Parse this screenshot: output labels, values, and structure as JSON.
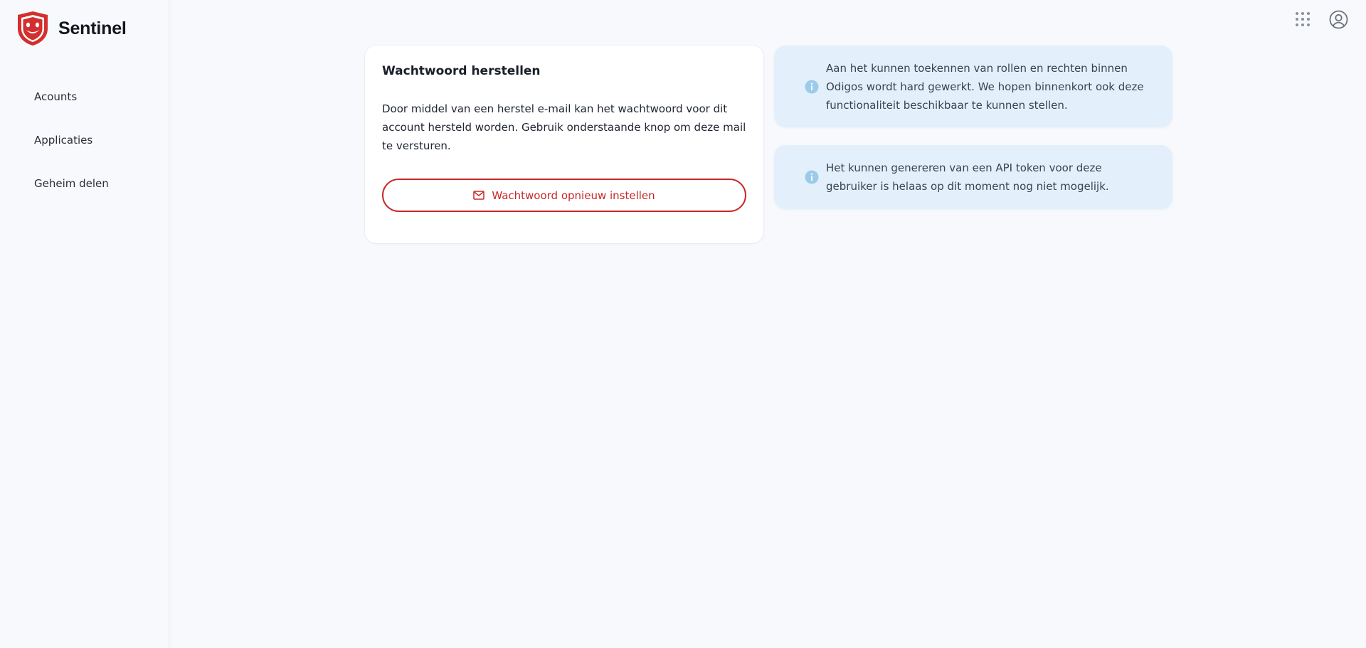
{
  "app": {
    "name": "Sentinel",
    "colors": {
      "brand": "#c62828",
      "info_bg": "#e3f0fb",
      "info_icon": "#9ccbea"
    }
  },
  "sidebar": {
    "items": [
      {
        "label": "Acounts"
      },
      {
        "label": "Applicaties"
      },
      {
        "label": "Geheim delen"
      }
    ]
  },
  "topbar": {
    "icons": [
      "apps-grid-icon",
      "user-account-icon"
    ]
  },
  "reset_card": {
    "title": "Wachtwoord herstellen",
    "description": "Door middel van een herstel e-mail kan het wachtwoord voor dit account hersteld worden. Gebruik onderstaande knop om deze mail te versturen.",
    "button_label": "Wachtwoord opnieuw instellen",
    "button_icon": "mail-icon"
  },
  "notices": [
    {
      "icon": "info-icon",
      "text": "Aan het kunnen toekennen van rollen en rechten binnen Odigos wordt hard gewerkt. We hopen binnenkort ook deze functionaliteit beschikbaar te kunnen stellen."
    },
    {
      "icon": "info-icon",
      "text": "Het kunnen genereren van een API token voor deze gebruiker is helaas op dit moment nog niet mogelijk."
    }
  ]
}
